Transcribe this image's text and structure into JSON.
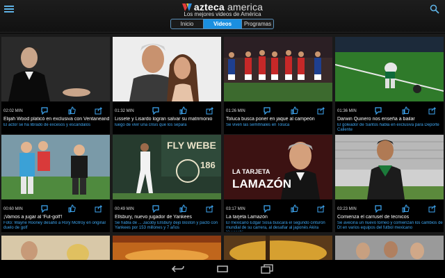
{
  "header": {
    "brand_strong": "azteca",
    "brand_light": " america",
    "subtitle": "Los mejores videos de América"
  },
  "tabs": [
    {
      "label": "Inicio"
    },
    {
      "label": "Videos",
      "selected": true
    },
    {
      "label": "Programas"
    }
  ],
  "colors": {
    "accent": "#1a8fe0",
    "link": "#3fa9f5"
  },
  "icons": {
    "card_actions": [
      "info-icon",
      "thumbs-up-icon",
      "share-icon"
    ],
    "menu": "hamburger-menu-icon",
    "search": "search-icon",
    "nav": [
      "back-icon",
      "home-icon",
      "recent-apps-icon"
    ]
  },
  "videos": [
    {
      "duration": "02:02 MIN",
      "title": "Elijah Wood platicó en exclusiva con VentaneandoUS",
      "desc": "El actor se ha librado de excesos y escándalos"
    },
    {
      "duration": "01:32 MIN",
      "title": "Lissete y Lisardo logran salvar su matrimonio",
      "desc": "luego de vivir una crisis que los separa"
    },
    {
      "duration": "01:26 MIN",
      "title": "Toluca busca poner en jaque al campeón",
      "desc": "Se viven las semifinales en Toluca"
    },
    {
      "duration": "01:36 MIN",
      "title": "Darwin Quinero nos enseña a bailar",
      "desc": "El goleador de Santos habla en exclusiva para Deporte Caliente"
    },
    {
      "duration": "00:60 MIN",
      "title": "¡Vamos a jugar al 'Fut-golf'!",
      "desc": "Foto: Wayne Rooney desafió a Rory McIlroy en original duelo de golf"
    },
    {
      "duration": "00:49 MIN",
      "title": "Ellsbury, nuevo jugador de Yankees",
      "desc": "Se habla de ... Jacoby Ellsbury dejó Boston y pactó con Yankees por 153 millones y 7 años"
    },
    {
      "duration": "03:17 MIN",
      "title": "La tarjeta Lamazón",
      "desc": "El mexicano Edgar Sosa buscará el segundo cinturón mundial de su carrera, al desafiar al japonés Akira Yaegashi"
    },
    {
      "duration": "03:23 MIN",
      "title": "Comienza el carrusel de tecnicos",
      "desc": "Se avecina un nuevo torneo y comienzan los cambios de Dt en varios equipos del futbol mexicano"
    }
  ],
  "thumb_text": {
    "lamazon_line1": "LA TARJETA",
    "lamazon_line2": "LAMAZÓN",
    "stadium_sign": "FLY WEBE",
    "jersey_number": "186"
  }
}
